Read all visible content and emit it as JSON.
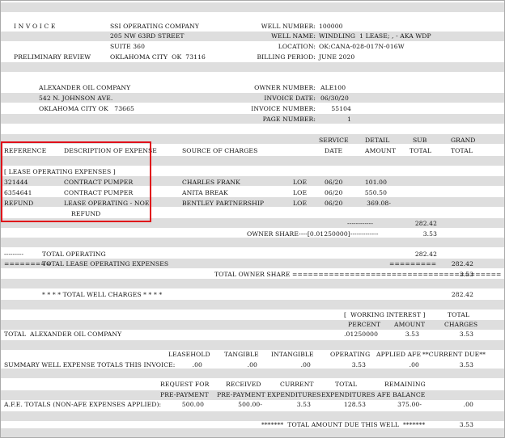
{
  "header": {
    "invoice_title": "I N V O I C E",
    "company_name": "SSI OPERATING COMPANY",
    "company_address1": "205 NW 63RD STREET",
    "company_address2": "SUITE 360",
    "company_city": "OKLAHOMA CITY  OK  73116",
    "preliminary_review": "PRELIMINARY REVIEW",
    "well_number_label": "WELL NUMBER:",
    "well_number": "100000",
    "well_name_label": "WELL NAME:",
    "well_name": "WINDLING  1 LEASE; , - AKA WDP",
    "location_label": "LOCATION:",
    "location": "OK:CANA-028-017N-016W",
    "billing_period_label": "BILLING PERIOD:",
    "billing_period": "JUNE 2020"
  },
  "owner": {
    "name": "ALEXANDER OIL COMPANY",
    "address": "542 N. JOHNSON AVE.",
    "city": "OKLAHOMA CITY OK   73665",
    "owner_number_label": "OWNER NUMBER:",
    "owner_number": "ALE100",
    "invoice_date_label": "INVOICE DATE:",
    "invoice_date": "06/30/20",
    "invoice_number_label": "INVOICE NUMBER:",
    "invoice_number": "55104",
    "page_number_label": "PAGE NUMBER:",
    "page_number": "1"
  },
  "columns": {
    "reference": "REFERENCE",
    "description": "DESCRIPTION OF EXPENSE",
    "source": "SOURCE OF CHARGES",
    "service": "SERVICE",
    "date": "DATE",
    "detail": "DETAIL",
    "amount": "AMOUNT",
    "sub": "SUB",
    "sub_total": "TOTAL",
    "grand": "GRAND",
    "grand_total": "TOTAL"
  },
  "section_title": "[ LEASE OPERATING EXPENSES ]",
  "rows": [
    {
      "ref": "321444",
      "desc": "CONTRACT PUMPER",
      "source": "CHARLES FRANK",
      "type": "LOE",
      "date": "06/20",
      "amount": "101.00"
    },
    {
      "ref": "6354641",
      "desc": "CONTRACT PUMPER",
      "source": "ANITA BREAK",
      "type": "LOE",
      "date": "06/20",
      "amount": "550.50"
    },
    {
      "ref": "REFUND",
      "desc": "LEASE OPERATING - NOE",
      "desc2": "REFUND",
      "source": "BENTLEY PARTNERSHIP",
      "type": "LOE",
      "date": "06/20",
      "amount": "369.08-"
    }
  ],
  "subtotal": {
    "dashes": "------------",
    "value": "282.42",
    "owner_share_text": "OWNER SHARE----[0.01250000]-------------",
    "owner_share_value": "3.53"
  },
  "totals": {
    "op_dashes": "---------",
    "total_operating": "TOTAL OPERATING",
    "total_operating_value": "282.42",
    "loe_marks": "=========",
    "total_loe": "TOTAL LEASE OPERATING EXPENSES",
    "loe_marks2": "=========",
    "total_loe_value": "282.42",
    "total_owner_share": "TOTAL OWNER SHARE ========================================",
    "total_owner_share_value": "3.53",
    "well_charges": "* * * * TOTAL WELL CHARGES * * * *",
    "well_charges_value": "282.42"
  },
  "working_interest": {
    "title": "[  WORKING INTEREST ]",
    "total_label": "TOTAL",
    "percent_label": "PERCENT",
    "amount_label": "AMOUNT",
    "charges_label": "CHARGES",
    "row_label": "TOTAL  ALEXANDER OIL COMPANY",
    "percent": ".01250000",
    "amount": "3.53",
    "charges": "3.53"
  },
  "summary": {
    "headers": [
      "LEASEHOLD",
      "TANGIBLE",
      "INTANGIBLE",
      "OPERATING",
      "APPLIED AFE",
      "**CURRENT DUE**"
    ],
    "label": "SUMMARY WELL EXPENSE TOTALS THIS INVOICE:",
    "values": [
      ".00",
      ".00",
      ".00",
      "3.53",
      ".00",
      "3.53"
    ]
  },
  "afe": {
    "headers_top": [
      "REQUEST FOR",
      "RECEIVED",
      "CURRENT",
      "TOTAL",
      "REMAINING"
    ],
    "headers_bottom": [
      "PRE-PAYMENT",
      "PRE-PAYMENT",
      "EXPENDITURES",
      "EXPENDITURES",
      "AFE BALANCE"
    ],
    "label": "A.F.E. TOTALS (NON-AFE EXPENSES APPLIED):",
    "values": [
      "500.00",
      "500.00-",
      "3.53",
      "128.53",
      "375.00-",
      ".00"
    ]
  },
  "amount_due": {
    "text": "*******  TOTAL AMOUNT DUE THIS WELL  *******",
    "value": "3.53"
  },
  "colors": {
    "band": "#dedede",
    "highlight_border": "#e0101a"
  }
}
